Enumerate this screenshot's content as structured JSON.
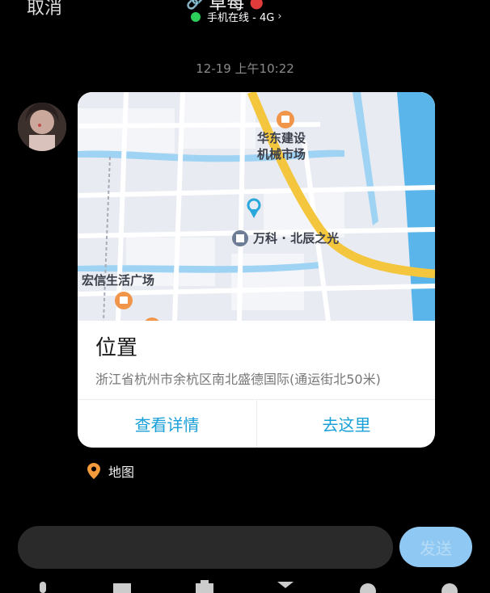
{
  "header": {
    "cancel_label": "取消",
    "contact_name": "草莓",
    "status_text": "手机在线 - 4G",
    "status_color": "#2dcf5b"
  },
  "message": {
    "timestamp": "12-19 上午10:22"
  },
  "location_card": {
    "map_labels": {
      "poi_top": "华东建设\n机械市场",
      "poi_center": "万科 · 北辰之光",
      "poi_left": "宏信生活广场"
    },
    "title": "位置",
    "address": "浙江省杭州市余杭区南北盛德国际(通运街北50米)",
    "btn_details": "查看详情",
    "btn_go": "去这里",
    "accent_color": "#1aa0d8"
  },
  "source": {
    "label": "地图",
    "icon": "map-pin-icon"
  },
  "composer": {
    "send_label": "发送"
  },
  "toolbar": {
    "icons": [
      "mic-icon",
      "image-icon",
      "camera-icon",
      "red-packet-icon",
      "emoji-icon",
      "plus-icon"
    ]
  }
}
